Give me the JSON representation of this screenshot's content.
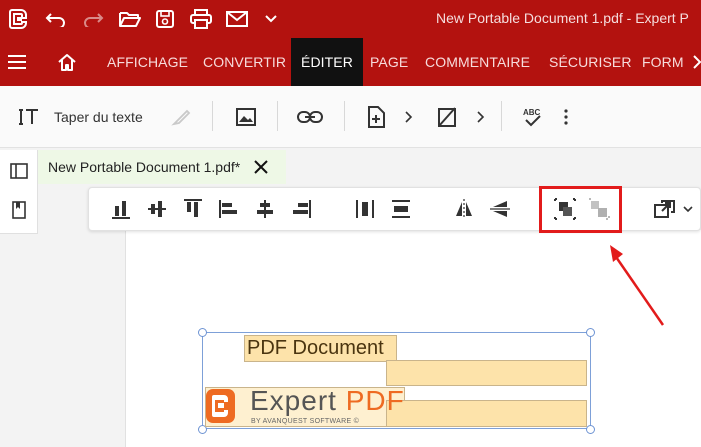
{
  "window": {
    "title": "New Portable Document 1.pdf - Expert P",
    "quick_access": [
      "app-logo-icon",
      "undo-icon",
      "redo-icon",
      "open-folder-icon",
      "save-icon",
      "print-icon",
      "email-icon",
      "chevron-down-icon"
    ]
  },
  "menu": {
    "items": [
      "AFFICHAGE",
      "CONVERTIR",
      "ÉDITER",
      "PAGE",
      "COMMENTAIRE",
      "SÉCURISER",
      "FORM"
    ],
    "active": "ÉDITER"
  },
  "toolbar": {
    "type_text_label": "Taper du texte",
    "buttons": [
      "text-cursor-icon",
      "brush-icon",
      "image-icon",
      "link-icon",
      "add-page-icon",
      "chevron-right-icon",
      "crop-icon",
      "chevron-right-icon",
      "spellcheck-icon",
      "more-icon"
    ]
  },
  "document_tab": {
    "label": "New Portable Document 1.pdf*"
  },
  "align_toolbar": {
    "buttons": [
      "align-bottom-icon",
      "align-middle-vertical-icon",
      "align-top-icon",
      "align-left-icon",
      "align-center-horizontal-icon",
      "align-right-icon",
      "distribute-horizontal-icon",
      "distribute-vertical-icon",
      "flip-horizontal-icon",
      "flip-vertical-icon",
      "group-icon",
      "ungroup-icon",
      "arrange-icon"
    ]
  },
  "document": {
    "heading": "PDF Document",
    "logo_word": "Expert ",
    "logo_pdf": "PDF",
    "logo_sub": "BY AVANQUEST SOFTWARE ©"
  },
  "colors": {
    "brand_red": "#b3120f",
    "highlight": "#e21b1b",
    "textbox_fill": "#fde3aa",
    "logo_orange": "#ee6b22"
  }
}
